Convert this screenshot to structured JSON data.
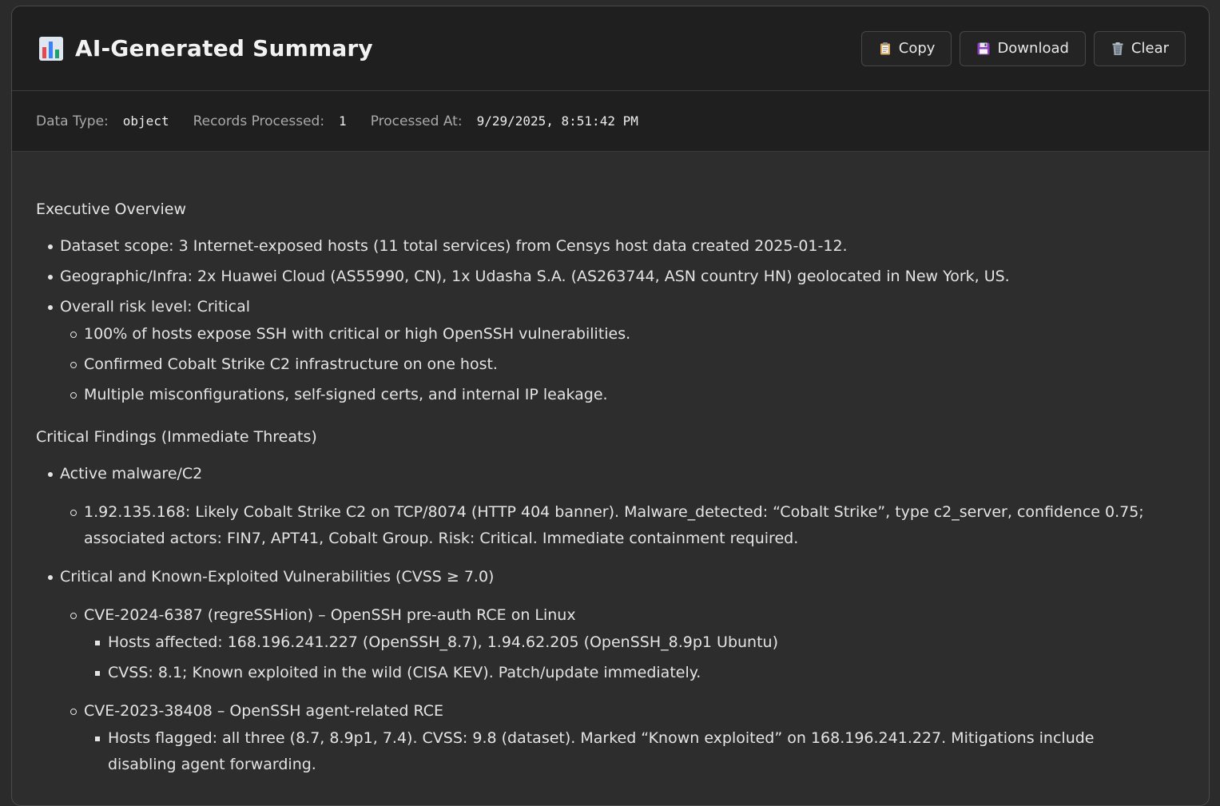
{
  "header": {
    "title": "AI-Generated Summary",
    "icon": "bar-chart-icon",
    "copy_label": "Copy",
    "download_label": "Download",
    "clear_label": "Clear"
  },
  "meta": {
    "data_type_label": "Data Type:",
    "data_type_value": "object",
    "records_label": "Records Processed:",
    "records_value": "1",
    "processed_label": "Processed At:",
    "processed_value": "9/29/2025, 8:51:42 PM"
  },
  "summary": {
    "exec_heading": "Executive Overview",
    "exec_items": [
      "Dataset scope: 3 Internet-exposed hosts (11 total services) from Censys host data created 2025-01-12.",
      "Geographic/Infra: 2x Huawei Cloud (AS55990, CN), 1x Udasha S.A. (AS263744, ASN country HN) geolocated in New York, US.",
      "Overall risk level: Critical"
    ],
    "risk_sub": [
      "100% of hosts expose SSH with critical or high OpenSSH vulnerabilities.",
      "Confirmed Cobalt Strike C2 infrastructure on one host.",
      "Multiple misconfigurations, self-signed certs, and internal IP leakage."
    ],
    "crit_heading": "Critical Findings (Immediate Threats)",
    "malware_heading": "Active malware/C2",
    "malware_item": "1.92.135.168: Likely Cobalt Strike C2 on TCP/8074 (HTTP 404 banner). Malware_detected: “Cobalt Strike”, type c2_server, confidence 0.75; associated actors: FIN7, APT41, Cobalt Group. Risk: Critical. Immediate containment required.",
    "vuln_heading": "Critical and Known-Exploited Vulnerabilities (CVSS ≥ 7.0)",
    "cve1_title": "CVE-2024-6387 (regreSSHion) – OpenSSH pre-auth RCE on Linux",
    "cve1_items": [
      "Hosts affected: 168.196.241.227 (OpenSSH_8.7), 1.94.62.205 (OpenSSH_8.9p1 Ubuntu)",
      "CVSS: 8.1; Known exploited in the wild (CISA KEV). Patch/update immediately."
    ],
    "cve2_title": "CVE-2023-38408 – OpenSSH agent-related RCE",
    "cve2_items": [
      "Hosts flagged: all three (8.7, 8.9p1, 7.4). CVSS: 9.8 (dataset). Marked “Known exploited” on 168.196.241.227. Mitigations include disabling agent forwarding."
    ]
  },
  "colors": {
    "background": "#2b2b2b",
    "header_bg": "#1f1f1f",
    "text": "#e4e4e4",
    "muted": "#a9a9a9"
  }
}
